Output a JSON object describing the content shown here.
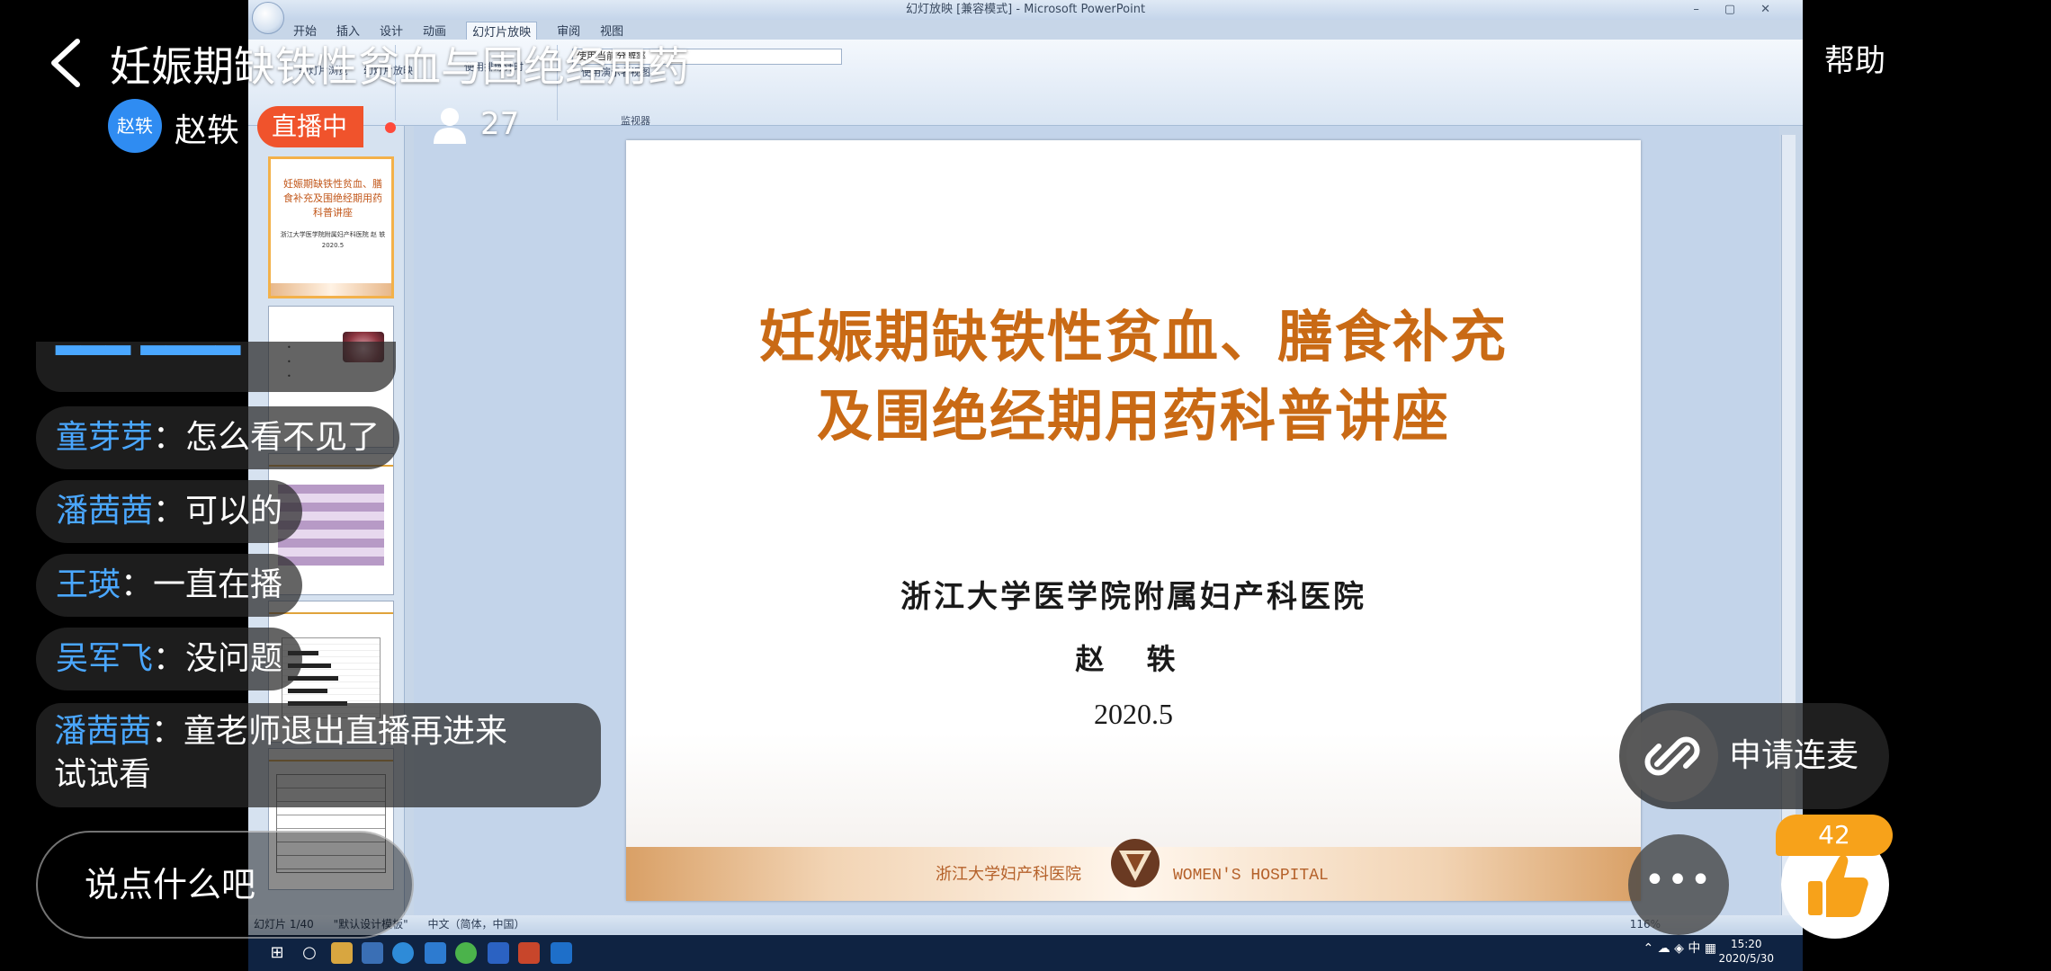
{
  "stream": {
    "title": "妊娠期缺铁性贫血与围绝经用药",
    "help_label": "帮助",
    "host": {
      "avatar_text": "赵轶",
      "name": "赵轶"
    },
    "live_badge": "直播中",
    "viewer_count": "27",
    "input_placeholder": "说点什么吧",
    "mic_label": "申请连麦",
    "more_label": "•••",
    "like_count": "42"
  },
  "chat": [
    {
      "nick": "童芽芽",
      "msg": "：怎么看不见了"
    },
    {
      "nick": "潘茜茜",
      "msg": "：可以的"
    },
    {
      "nick": "王瑛",
      "msg": "：一直在播"
    },
    {
      "nick": "吴军飞",
      "msg": "：没问题"
    },
    {
      "nick": "潘茜茜",
      "msg": "：童老师退出直播再进来",
      "msg_line2": "试试看"
    }
  ],
  "ppt": {
    "window_title": "幻灯放映 [兼容模式] - Microsoft PowerPoint",
    "tabs": [
      "开始",
      "插入",
      "设计",
      "动画",
      "幻灯片放映",
      "审阅",
      "视图"
    ],
    "ribbon": {
      "group_label": "监视器",
      "row1": "幻灯片浏览",
      "row2": "幻灯片放映",
      "combo_value": "使用当前分辨率",
      "check1": "使用排练计时",
      "check2": "使用演示者视图"
    },
    "status": {
      "slide_info": "幻灯片 1/40",
      "theme": "\"默认设计模板\"",
      "lang": "中文（简体，中国）",
      "zoom": "116%"
    },
    "thumb1": {
      "title": "妊娠期缺铁性贫血、膳食补充及围绝经期用药科普讲座",
      "sub": "浙江大学医学院附属妇产科医院 赵 轶 2020.5"
    },
    "slide": {
      "title_line1": "妊娠期缺铁性贫血、膳食补充",
      "title_line2": "及围绝经期用药科普讲座",
      "institution": "浙江大学医学院附属妇产科医院",
      "presenter": "赵 轶",
      "date": "2020.5",
      "footer_cn": "浙江大学妇产科医院",
      "footer_en": "WOMEN'S HOSPITAL"
    }
  },
  "taskbar": {
    "time": "15:20",
    "date": "2020/5/30",
    "ime": "中"
  }
}
